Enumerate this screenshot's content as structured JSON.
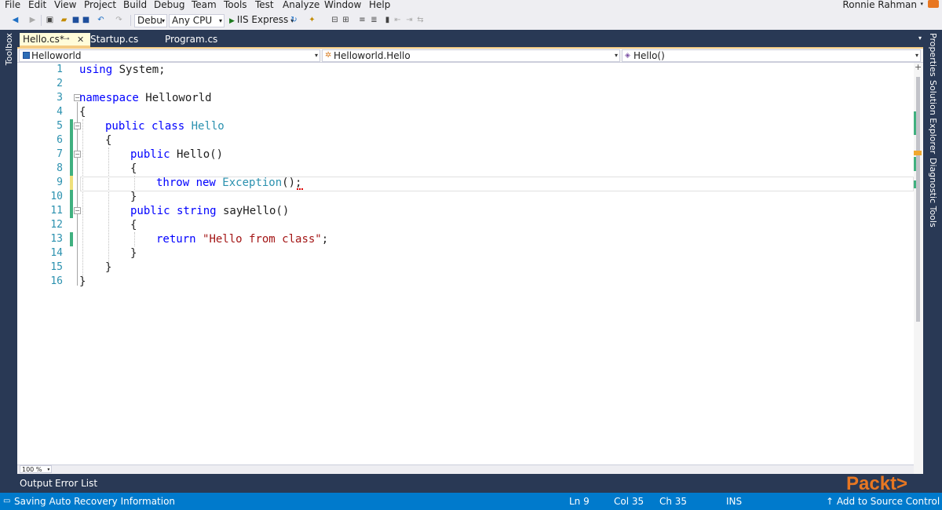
{
  "menu": [
    "File",
    "Edit",
    "View",
    "Project",
    "Build",
    "Debug",
    "Team",
    "Tools",
    "Test",
    "Analyze",
    "Window",
    "Help"
  ],
  "user": "Ronnie Rahman",
  "toolbar": {
    "config": "Debu",
    "platform": "Any CPU",
    "run_target": "IIS Express"
  },
  "side": {
    "left": "Toolbox",
    "right": [
      "Properties",
      "Solution Explorer",
      "Diagnostic Tools"
    ]
  },
  "tabs": [
    {
      "label": "Hello.cs*",
      "active": true
    },
    {
      "label": "Startup.cs",
      "active": false
    },
    {
      "label": "Program.cs",
      "active": false
    }
  ],
  "nav": {
    "project": "Helloworld",
    "type": "Helloworld.Hello",
    "member": "Hello()"
  },
  "code": {
    "line_numbers": [
      "1",
      "2",
      "3",
      "4",
      "5",
      "6",
      "7",
      "8",
      "9",
      "10",
      "11",
      "12",
      "13",
      "14",
      "15",
      "16"
    ],
    "l1_kw": "using",
    "l1_rest": " System;",
    "l3_kw": "namespace",
    "l3_rest": " Helloworld",
    "l4": "{",
    "l5_kw": "public class",
    "l5_ty": "Hello",
    "l6": "{",
    "l7_kw": "public",
    "l7_rest": " Hello()",
    "l8": "{",
    "l9_kw": "throw new",
    "l9_ty": "Exception",
    "l9_rest": "();",
    "l10": "}",
    "l11_kw": "public string",
    "l11_rest": " sayHello()",
    "l12": "{",
    "l13_kw": "return",
    "l13_str": "\"Hello from class\"",
    "l13_rest": ";",
    "l14": "}",
    "l15": "}",
    "l16": "}"
  },
  "zoom": "100 %",
  "panels": [
    "Output",
    "Error List"
  ],
  "logo": "Packt>",
  "status": {
    "message": "Saving Auto Recovery Information",
    "ln": "Ln 9",
    "col": "Col 35",
    "ch": "Ch 35",
    "mode": "INS",
    "source_control": "↑ Add to Source Control ▴"
  },
  "colors": {
    "keyword": "#0000ff",
    "type": "#2b91af",
    "string": "#a31515",
    "status_bar": "#007acc",
    "chrome": "#293955"
  }
}
